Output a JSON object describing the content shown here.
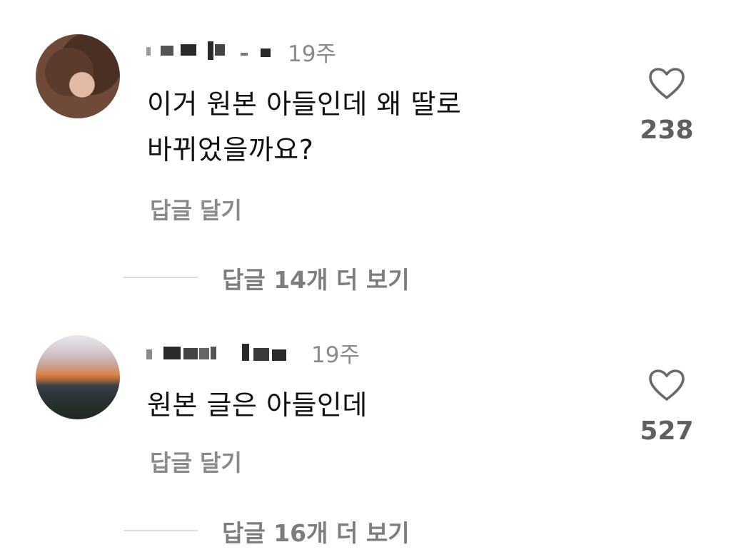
{
  "comments": [
    {
      "time": "19주",
      "text_lines": [
        "이거 원본 아들인데 왜 딸로",
        "바뀌었을까요?"
      ],
      "reply_label": "답글 달기",
      "like_count": "238",
      "more_replies_label": "답글 14개 더 보기"
    },
    {
      "time": "19주",
      "text_lines": [
        "원본 글은 아들인데"
      ],
      "reply_label": "답글 달기",
      "like_count": "527",
      "more_replies_label": "답글 16개 더 보기"
    }
  ],
  "icons": {
    "like": "heart-outline-icon"
  },
  "colors": {
    "secondary_text": "#8a8a8a",
    "like_count": "#5f5f5f",
    "more_replies": "#7d7d7d",
    "divider": "#dcdcdc"
  }
}
